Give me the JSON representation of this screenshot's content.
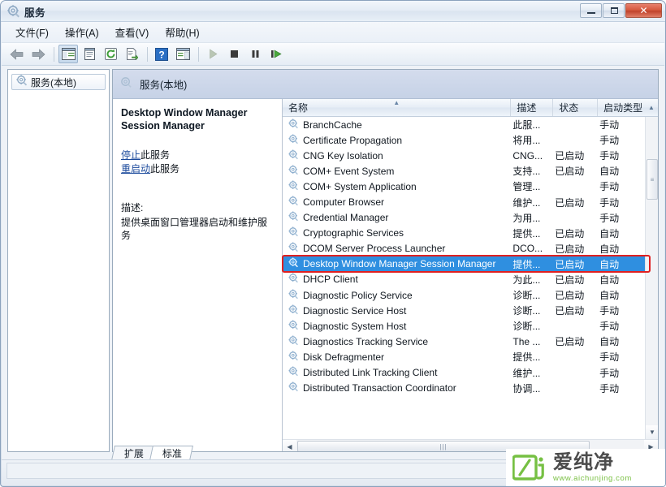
{
  "window": {
    "title": "服务",
    "title_icon": "services-gear-icon",
    "minimize_label": "最小化",
    "maximize_label": "最大化",
    "close_label": "关闭",
    "close_glyph": "✕"
  },
  "menubar": {
    "items": [
      {
        "label": "文件(F)",
        "name": "menu-file"
      },
      {
        "label": "操作(A)",
        "name": "menu-action"
      },
      {
        "label": "查看(V)",
        "name": "menu-view"
      },
      {
        "label": "帮助(H)",
        "name": "menu-help"
      }
    ]
  },
  "toolbar": {
    "buttons": [
      {
        "name": "back-icon",
        "glyph": "⬅",
        "pressed": false,
        "enabled": true
      },
      {
        "name": "forward-icon",
        "glyph": "➡",
        "pressed": false,
        "enabled": true
      },
      {
        "name": "show-hide-tree-icon",
        "glyph": "▤",
        "pressed": true,
        "enabled": true
      },
      {
        "name": "properties-icon",
        "glyph": "▤",
        "pressed": false,
        "enabled": true
      },
      {
        "name": "refresh-icon",
        "glyph": "⟳",
        "pressed": false,
        "enabled": true
      },
      {
        "name": "export-list-icon",
        "glyph": "⇨",
        "pressed": false,
        "enabled": true
      },
      {
        "name": "help-icon",
        "glyph": "?",
        "pressed": false,
        "enabled": true
      },
      {
        "name": "show-action-pane-icon",
        "glyph": "▤",
        "pressed": false,
        "enabled": true
      },
      {
        "name": "start-service-icon",
        "glyph": "▶",
        "pressed": false,
        "enabled": false
      },
      {
        "name": "stop-service-icon",
        "glyph": "■",
        "pressed": false,
        "enabled": true
      },
      {
        "name": "pause-service-icon",
        "glyph": "❚❚",
        "pressed": false,
        "enabled": true
      },
      {
        "name": "restart-service-icon",
        "glyph": "❚▶",
        "pressed": false,
        "enabled": true
      }
    ]
  },
  "tree": {
    "nodes": [
      {
        "label": "服务(本地)",
        "name": "tree-node-services-local",
        "icon": "services-gear-icon"
      }
    ]
  },
  "content": {
    "header": "服务(本地)",
    "header_icon": "services-gear-icon"
  },
  "detail": {
    "title_line1": "Desktop Window Manager",
    "title_line2": "Session Manager",
    "links": [
      {
        "name": "stop-service-link",
        "link_text": "停止",
        "suffix": "此服务"
      },
      {
        "name": "restart-service-link",
        "link_text": "重启动",
        "suffix": "此服务"
      }
    ],
    "description_label": "描述:",
    "description_text": "提供桌面窗口管理器启动和维护服务"
  },
  "list": {
    "columns": [
      {
        "key": "name",
        "label": "名称",
        "sorted": true
      },
      {
        "key": "desc",
        "label": "描述",
        "sorted": false
      },
      {
        "key": "state",
        "label": "状态",
        "sorted": false
      },
      {
        "key": "start",
        "label": "启动类型",
        "sorted": false
      }
    ],
    "sort_caret": "▲",
    "rows": [
      {
        "name": "BranchCache",
        "desc": "此服...",
        "state": "",
        "start": "手动",
        "selected": false
      },
      {
        "name": "Certificate Propagation",
        "desc": "将用...",
        "state": "",
        "start": "手动",
        "selected": false
      },
      {
        "name": "CNG Key Isolation",
        "desc": "CNG...",
        "state": "已启动",
        "start": "手动",
        "selected": false
      },
      {
        "name": "COM+ Event System",
        "desc": "支持...",
        "state": "已启动",
        "start": "自动",
        "selected": false
      },
      {
        "name": "COM+ System Application",
        "desc": "管理...",
        "state": "",
        "start": "手动",
        "selected": false
      },
      {
        "name": "Computer Browser",
        "desc": "维护...",
        "state": "已启动",
        "start": "手动",
        "selected": false
      },
      {
        "name": "Credential Manager",
        "desc": "为用...",
        "state": "",
        "start": "手动",
        "selected": false
      },
      {
        "name": "Cryptographic Services",
        "desc": "提供...",
        "state": "已启动",
        "start": "自动",
        "selected": false
      },
      {
        "name": "DCOM Server Process Launcher",
        "desc": "DCO...",
        "state": "已启动",
        "start": "自动",
        "selected": false
      },
      {
        "name": "Desktop Window Manager Session Manager",
        "desc": "提供...",
        "state": "已启动",
        "start": "自动",
        "selected": true
      },
      {
        "name": "DHCP Client",
        "desc": "为此...",
        "state": "已启动",
        "start": "自动",
        "selected": false
      },
      {
        "name": "Diagnostic Policy Service",
        "desc": "诊断...",
        "state": "已启动",
        "start": "自动",
        "selected": false
      },
      {
        "name": "Diagnostic Service Host",
        "desc": "诊断...",
        "state": "已启动",
        "start": "手动",
        "selected": false
      },
      {
        "name": "Diagnostic System Host",
        "desc": "诊断...",
        "state": "",
        "start": "手动",
        "selected": false
      },
      {
        "name": "Diagnostics Tracking Service",
        "desc": "The ...",
        "state": "已启动",
        "start": "自动",
        "selected": false
      },
      {
        "name": "Disk Defragmenter",
        "desc": "提供...",
        "state": "",
        "start": "手动",
        "selected": false
      },
      {
        "name": "Distributed Link Tracking Client",
        "desc": "维护...",
        "state": "",
        "start": "手动",
        "selected": false
      },
      {
        "name": "Distributed Transaction Coordinator",
        "desc": "协调...",
        "state": "",
        "start": "手动",
        "selected": false
      }
    ],
    "row_icon": "service-gear-icon",
    "scroll": {
      "up_arrow": "▲",
      "down_arrow": "▼",
      "left_arrow": "◀",
      "right_arrow": "▶",
      "v_thumb_grip": "≡",
      "h_thumb_grip": "|||"
    }
  },
  "tabs": [
    {
      "label": "扩展",
      "name": "tab-extended",
      "active": false
    },
    {
      "label": "标准",
      "name": "tab-standard",
      "active": true
    }
  ],
  "watermark": {
    "brand": "爱纯净",
    "url": "www.aichunjing.com",
    "logo_color": "#76c043",
    "text_color": "#4c4c4c"
  },
  "colors": {
    "selection_blue": "#2f8fe0",
    "annotation_red": "#e02020",
    "link_blue": "#1b4a9c",
    "accent_green": "#76c043"
  }
}
